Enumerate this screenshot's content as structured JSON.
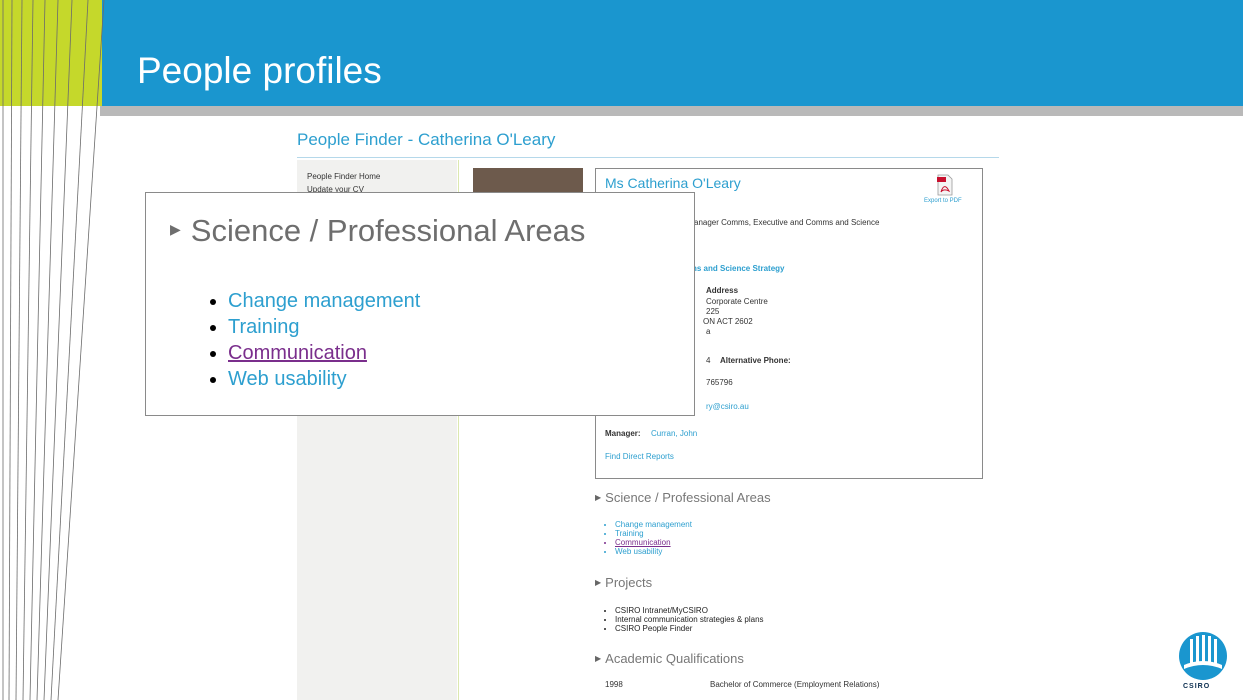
{
  "slide": {
    "title": "People profiles",
    "accent_color": "#1a96cf",
    "stripe_color": "#c5d82b"
  },
  "webpage": {
    "title": "People Finder - Catherina O'Leary",
    "sidebar_nav": [
      "People Finder Home",
      "Update your CV"
    ],
    "card": {
      "name": "Ms Catherina O'Leary",
      "pdf_icon": "pdf-icon",
      "pdf_label": "Export to PDF",
      "position_text": "anager Comms, Executive and Comms and Science",
      "unit_link": "ns and Science Strategy",
      "address_heading": "Address",
      "address_lines": [
        "Corporate Centre",
        "225",
        "ON ACT 2602",
        "a"
      ],
      "phone_fragment": "4",
      "alt_phone_label": "Alternative Phone:",
      "mobile_fragment": "765796",
      "email_fragment": "ry@csiro.au",
      "manager_label": "Manager:",
      "manager_link": "Curran, John",
      "direct_reports_link": "Find Direct Reports"
    },
    "sections": {
      "science": {
        "heading": "Science / Professional Areas",
        "items": [
          "Change management",
          "Training",
          "Communication",
          "Web usability"
        ]
      },
      "projects": {
        "heading": "Projects",
        "items": [
          "CSIRO Intranet/MyCSIRO",
          "Internal communication strategies & plans",
          "CSIRO People Finder"
        ]
      },
      "academic": {
        "heading": "Academic Qualifications",
        "rows": [
          {
            "year": "1998",
            "qualification": "Bachelor of Commerce (Employment Relations)"
          }
        ]
      }
    }
  },
  "callout": {
    "heading": "Science / Professional Areas",
    "items": [
      "Change management",
      "Training",
      "Communication",
      "Web usability"
    ]
  },
  "logo": {
    "text": "CSIRO",
    "icon": "csiro-logo-icon"
  }
}
